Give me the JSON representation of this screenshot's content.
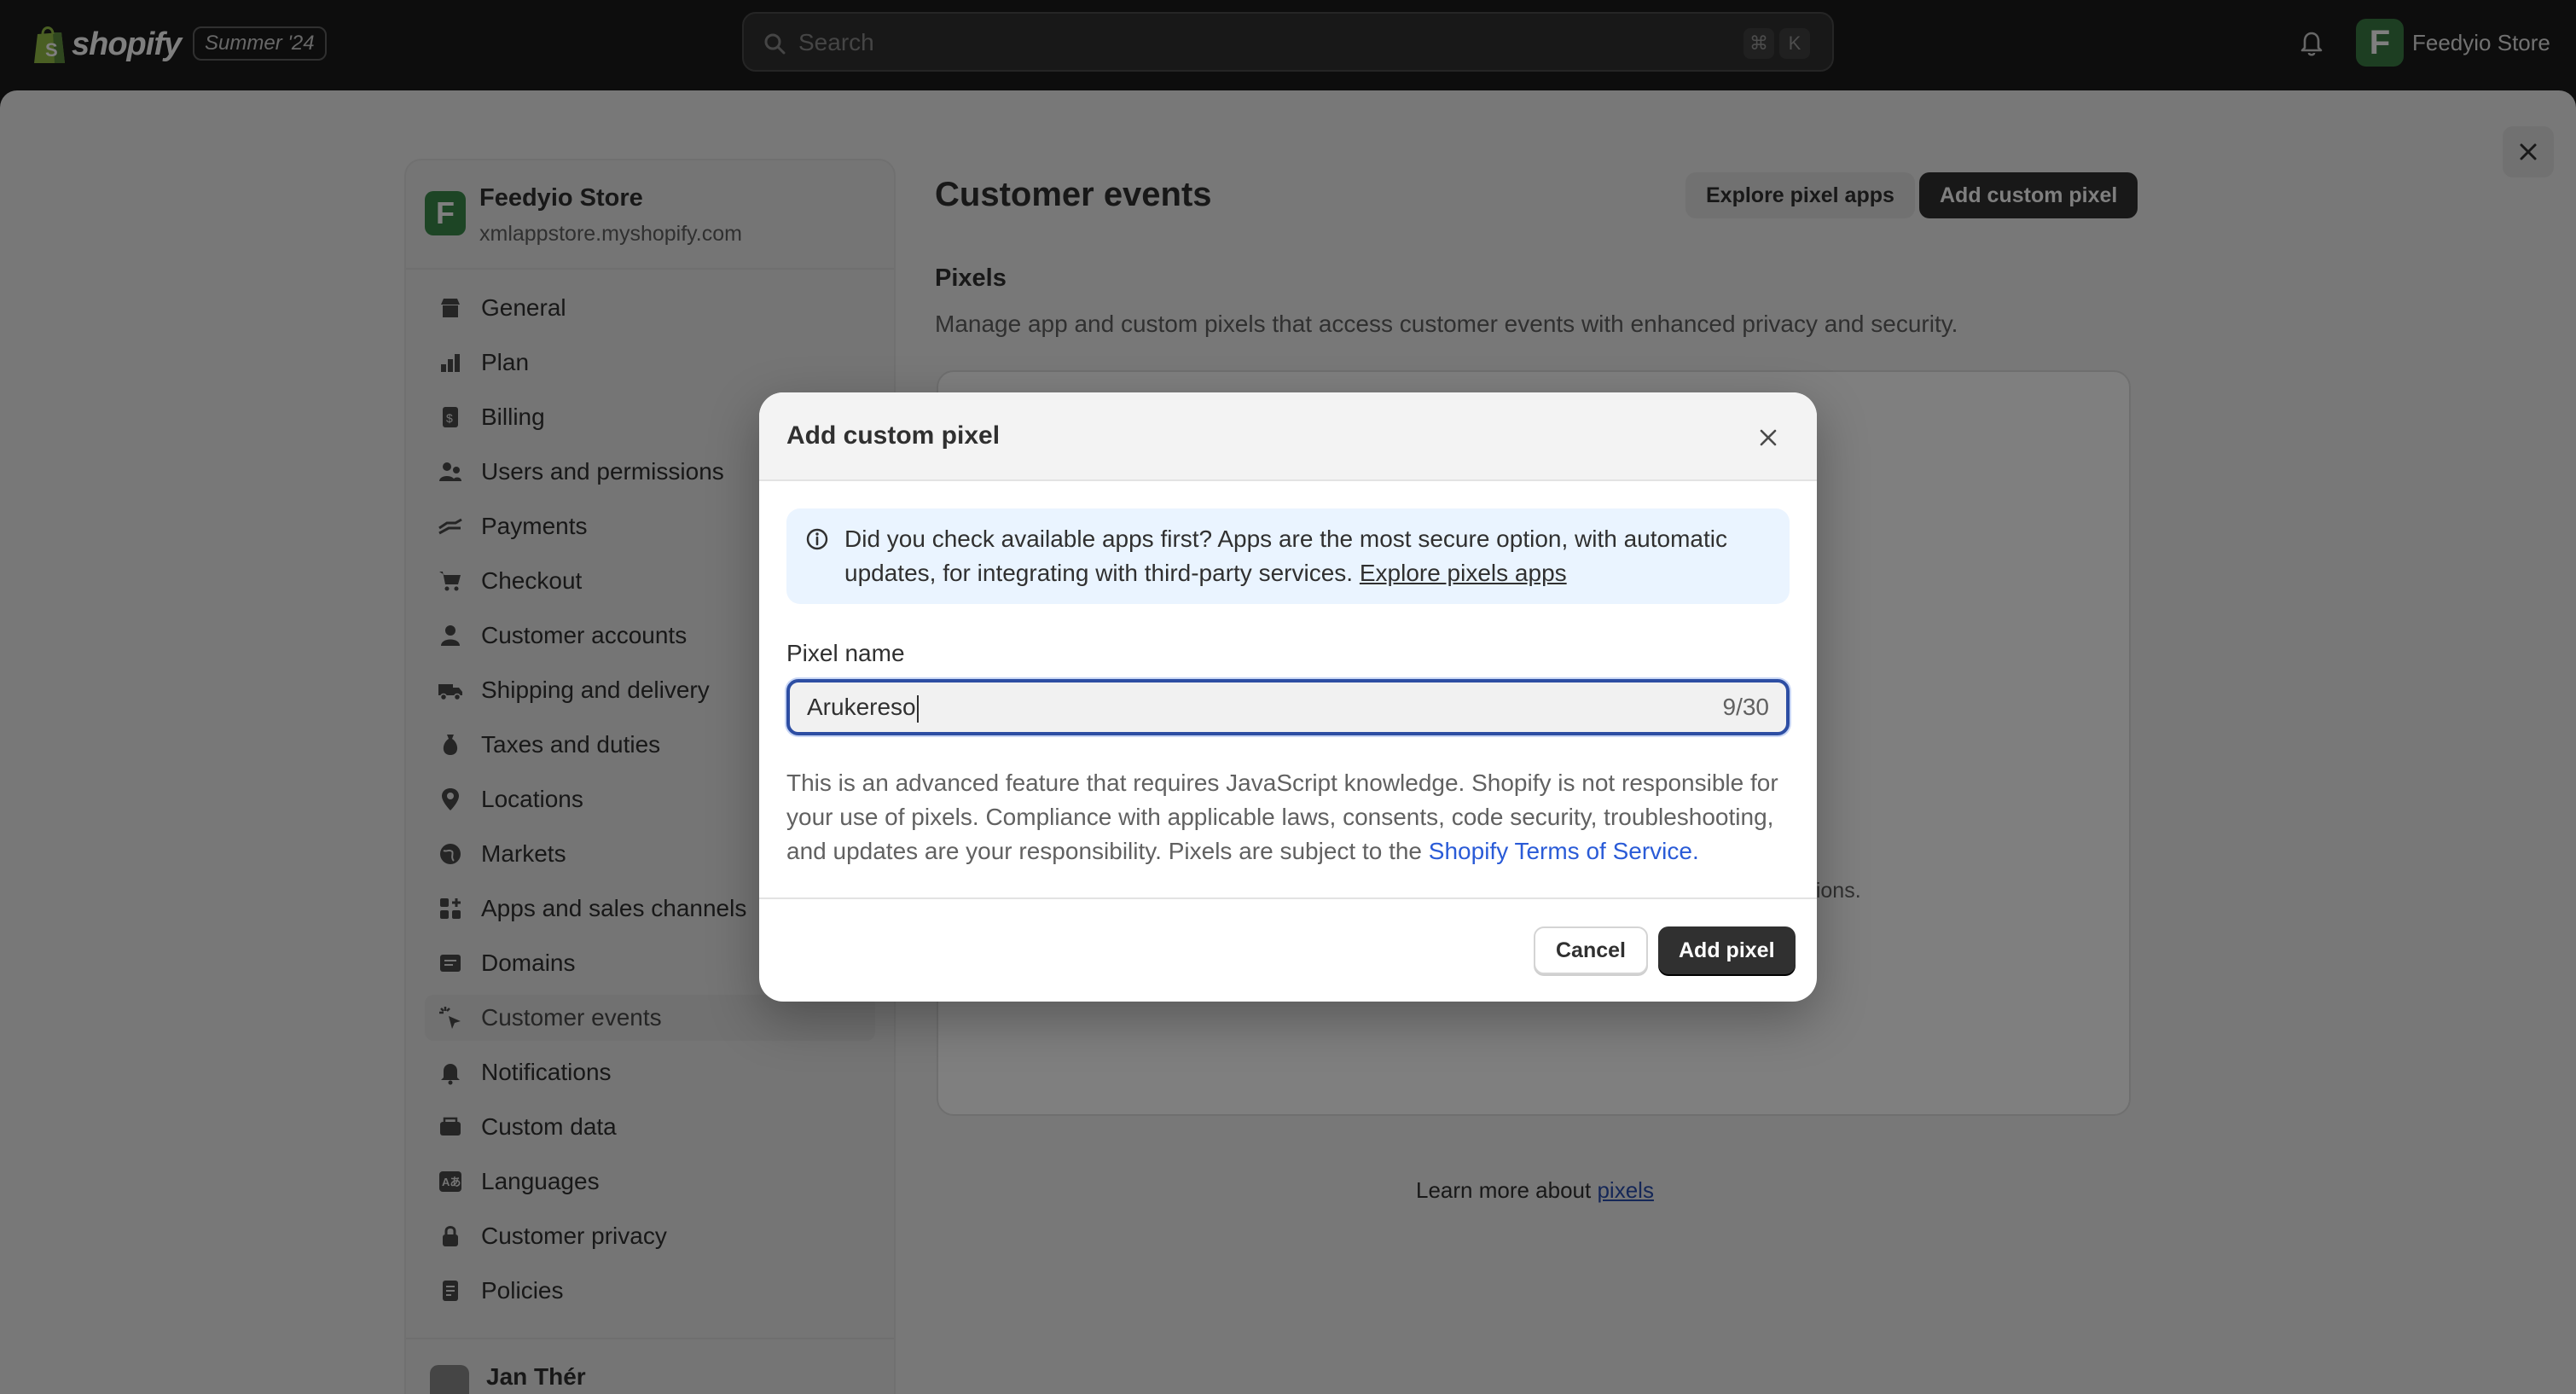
{
  "topbar": {
    "brand": "shopify",
    "edition": "Summer '24",
    "search_placeholder": "Search",
    "shortcut_mod": "⌘",
    "shortcut_key": "K",
    "store_initial": "F",
    "store_name": "Feedyio Store"
  },
  "sidebar": {
    "store_initial": "F",
    "store_name": "Feedyio Store",
    "store_domain": "xmlappstore.myshopify.com",
    "items": [
      {
        "label": "General",
        "icon": "store-icon"
      },
      {
        "label": "Plan",
        "icon": "plan-icon"
      },
      {
        "label": "Billing",
        "icon": "billing-icon"
      },
      {
        "label": "Users and permissions",
        "icon": "users-icon"
      },
      {
        "label": "Payments",
        "icon": "payments-icon"
      },
      {
        "label": "Checkout",
        "icon": "cart-icon"
      },
      {
        "label": "Customer accounts",
        "icon": "person-icon"
      },
      {
        "label": "Shipping and delivery",
        "icon": "truck-icon"
      },
      {
        "label": "Taxes and duties",
        "icon": "tax-icon"
      },
      {
        "label": "Locations",
        "icon": "location-pin-icon"
      },
      {
        "label": "Markets",
        "icon": "globe-icon"
      },
      {
        "label": "Apps and sales channels",
        "icon": "apps-icon"
      },
      {
        "label": "Domains",
        "icon": "domain-icon"
      },
      {
        "label": "Customer events",
        "icon": "cursor-icon",
        "active": true
      },
      {
        "label": "Notifications",
        "icon": "bell-icon"
      },
      {
        "label": "Custom data",
        "icon": "database-icon"
      },
      {
        "label": "Languages",
        "icon": "language-icon"
      },
      {
        "label": "Customer privacy",
        "icon": "lock-icon"
      },
      {
        "label": "Policies",
        "icon": "policy-icon"
      }
    ],
    "user_name": "Jan Thér"
  },
  "main": {
    "title": "Customer events",
    "explore_button": "Explore pixel apps",
    "add_custom_button": "Add custom pixel",
    "section_title": "Pixels",
    "section_desc": "Manage app and custom pixels that access customer events with enhanced privacy and security.",
    "card_partial_text": "ations.",
    "learn_prefix": "Learn more about ",
    "learn_link": "pixels"
  },
  "modal": {
    "title": "Add custom pixel",
    "banner_text": "Did you check available apps first? Apps are the most secure option, with automatic updates, for integrating with third-party services. ",
    "banner_link": "Explore pixels apps",
    "field_label": "Pixel name",
    "field_value": "Arukereso",
    "field_count": "9/30",
    "legal_text": "This is an advanced feature that requires JavaScript knowledge. Shopify is not responsible for your use of pixels. Compliance with applicable laws, consents, code security, troubleshooting, and updates are your responsibility. Pixels are subject to the ",
    "legal_link": "Shopify Terms of Service",
    "legal_end": ".",
    "cancel_button": "Cancel",
    "add_button": "Add pixel"
  },
  "colors": {
    "topbar_bg": "#1a1a1a",
    "primary_button": "#303030",
    "focus_ring": "#2d4ea3",
    "link": "#2a5bd7",
    "info_banner": "#eaf4ff",
    "brand_green": "#3a7d44"
  }
}
